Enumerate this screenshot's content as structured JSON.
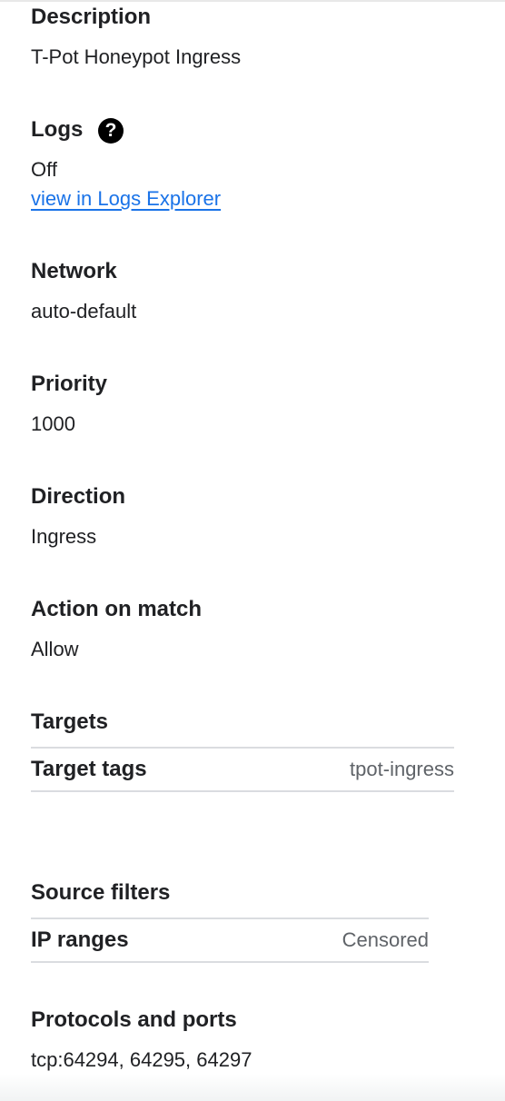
{
  "description": {
    "label": "Description",
    "value": "T-Pot Honeypot Ingress"
  },
  "logs": {
    "label": "Logs",
    "help_icon": "help-circle-icon",
    "help_glyph": "?",
    "value": "Off",
    "link_text": "view in Logs Explorer"
  },
  "network": {
    "label": "Network",
    "value": "auto-default"
  },
  "priority": {
    "label": "Priority",
    "value": "1000"
  },
  "direction": {
    "label": "Direction",
    "value": "Ingress"
  },
  "action": {
    "label": "Action on match",
    "value": "Allow"
  },
  "targets": {
    "label": "Targets",
    "rows": [
      {
        "key": "Target tags",
        "value": "tpot-ingress"
      }
    ]
  },
  "source_filters": {
    "label": "Source filters",
    "rows": [
      {
        "key": "IP ranges",
        "value": "Censored"
      }
    ]
  },
  "protocols": {
    "label": "Protocols and ports",
    "value": "tcp:64294, 64295, 64297"
  },
  "colors": {
    "text": "#202124",
    "link": "#1a73e8",
    "muted": "#5f6368",
    "divider": "#dadce0"
  }
}
